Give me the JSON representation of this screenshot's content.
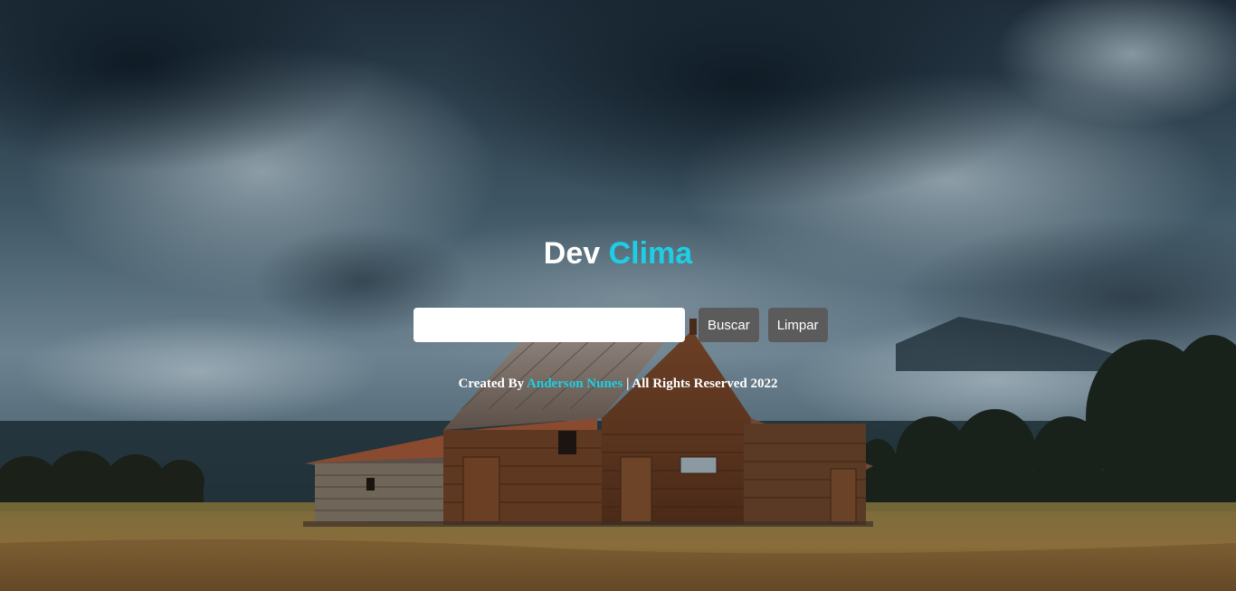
{
  "app": {
    "title_part1": "Dev",
    "title_part2": "Clima",
    "accent_color": "#1ccfe6"
  },
  "search": {
    "value": "",
    "placeholder": ""
  },
  "buttons": {
    "search_label": "Buscar",
    "clear_label": "Limpar"
  },
  "footer": {
    "prefix": "Created By",
    "author": "Anderson Nunes",
    "suffix": "| All Rights Reserved 2022"
  },
  "background": {
    "description_icon": "barn-storm-landscape"
  }
}
